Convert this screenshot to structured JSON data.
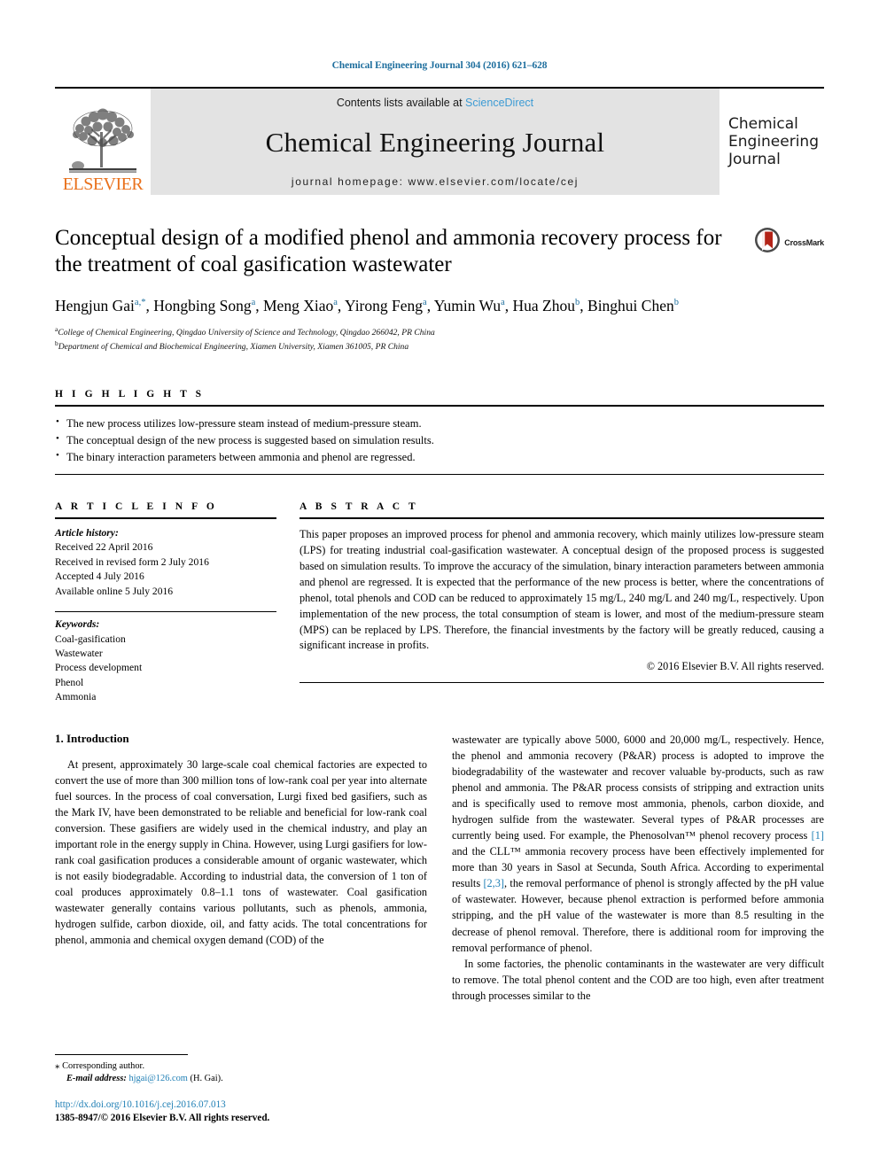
{
  "running_head": "Chemical Engineering Journal 304 (2016) 621–628",
  "masthead": {
    "contents_prefix": "Contents lists available at ",
    "sciencedirect": "ScienceDirect",
    "journal_name": "Chemical Engineering Journal",
    "homepage": "journal homepage: www.elsevier.com/locate/cej",
    "publisher_wordmark": "ELSEVIER",
    "cover_line1": "Chemical",
    "cover_line2": "Engineering",
    "cover_line3": "Journal",
    "band_color": "#e3e3e3",
    "sciencedirect_color": "#3d9bd4",
    "elsevier_orange": "#E9711C"
  },
  "article": {
    "title": "Conceptual design of a modified phenol and ammonia recovery process for the treatment of coal gasification wastewater",
    "crossmark_label": "CrossMark",
    "authors": [
      {
        "name": "Hengjun Gai",
        "marks": "a,*"
      },
      {
        "name": "Hongbing Song",
        "marks": "a"
      },
      {
        "name": "Meng Xiao",
        "marks": "a"
      },
      {
        "name": "Yirong Feng",
        "marks": "a"
      },
      {
        "name": "Yumin Wu",
        "marks": "a"
      },
      {
        "name": "Hua Zhou",
        "marks": "b"
      },
      {
        "name": "Binghui Chen",
        "marks": "b"
      }
    ],
    "affiliations": [
      {
        "mark": "a",
        "text": "College of Chemical Engineering, Qingdao University of Science and Technology, Qingdao 266042, PR China"
      },
      {
        "mark": "b",
        "text": "Department of Chemical and Biochemical Engineering, Xiamen University, Xiamen 361005, PR China"
      }
    ]
  },
  "highlights": {
    "heading": "H I G H L I G H T S",
    "items": [
      "The new process utilizes low-pressure steam instead of medium-pressure steam.",
      "The conceptual design of the new process is suggested based on simulation results.",
      "The binary interaction parameters between ammonia and phenol are regressed."
    ]
  },
  "article_info": {
    "heading": "A R T I C L E   I N F O",
    "history_title": "Article history:",
    "history": [
      "Received 22 April 2016",
      "Received in revised form 2 July 2016",
      "Accepted 4 July 2016",
      "Available online 5 July 2016"
    ],
    "keywords_title": "Keywords:",
    "keywords": [
      "Coal-gasification",
      "Wastewater",
      "Process development",
      "Phenol",
      "Ammonia"
    ]
  },
  "abstract": {
    "heading": "A B S T R A C T",
    "text": "This paper proposes an improved process for phenol and ammonia recovery, which mainly utilizes low-pressure steam (LPS) for treating industrial coal-gasification wastewater. A conceptual design of the proposed process is suggested based on simulation results. To improve the accuracy of the simulation, binary interaction parameters between ammonia and phenol are regressed. It is expected that the performance of the new process is better, where the concentrations of phenol, total phenols and COD can be reduced to approximately 15 mg/L, 240 mg/L and 240 mg/L, respectively. Upon implementation of the new process, the total consumption of steam is lower, and most of the medium-pressure steam (MPS) can be replaced by LPS. Therefore, the financial investments by the factory will be greatly reduced, causing a significant increase in profits.",
    "copyright": "© 2016 Elsevier B.V. All rights reserved."
  },
  "body": {
    "section_heading": "1. Introduction",
    "left_paragraph_1": "At present, approximately 30 large-scale coal chemical factories are expected to convert the use of more than 300 million tons of low-rank coal per year into alternate fuel sources. In the process of coal conversation, Lurgi fixed bed gasifiers, such as the Mark IV, have been demonstrated to be reliable and beneficial for low-rank coal conversion. These gasifiers are widely used in the chemical industry, and play an important role in the energy supply in China. However, using Lurgi gasifiers for low-rank coal gasification produces a considerable amount of organic wastewater, which is not easily biodegradable. According to industrial data, the conversion of 1 ton of coal produces approximately 0.8–1.1 tons of wastewater. Coal gasification wastewater generally contains various pollutants, such as phenols, ammonia, hydrogen sulfide, carbon dioxide, oil, and fatty acids. The total concentrations for phenol, ammonia and chemical oxygen demand (COD) of the",
    "right_paragraph_1_a": "wastewater are typically above 5000, 6000 and 20,000 mg/L, respectively. Hence, the phenol and ammonia recovery (P&AR) process is adopted to improve the biodegradability of the wastewater and recover valuable by-products, such as raw phenol and ammonia. The P&AR process consists of stripping and extraction units and is specifically used to remove most ammonia, phenols, carbon dioxide, and hydrogen sulfide from the wastewater. Several types of P&AR processes are currently being used. For example, the Phenosolvan™ phenol recovery process ",
    "right_ref_1": "[1]",
    "right_paragraph_1_b": " and the CLL™ ammonia recovery process have been effectively implemented for more than 30 years in Sasol at Secunda, South Africa. According to experimental results ",
    "right_ref_2": "[2,3]",
    "right_paragraph_1_c": ", the removal performance of phenol is strongly affected by the pH value of wastewater. However, because phenol extraction is performed before ammonia stripping, and the pH value of the wastewater is more than 8.5 resulting in the decrease of phenol removal. Therefore, there is additional room for improving the removal performance of phenol.",
    "right_paragraph_2": "In some factories, the phenolic contaminants in the wastewater are very difficult to remove. The total phenol content and the COD are too high, even after treatment through processes similar to the"
  },
  "footer": {
    "corresponding_star": "⁎",
    "corresponding_text": "Corresponding author.",
    "email_label": "E-mail address:",
    "email_address": "hjgai@126.com",
    "email_suffix": "(H. Gai).",
    "doi": "http://dx.doi.org/10.1016/j.cej.2016.07.013",
    "issn_line": "1385-8947/© 2016 Elsevier B.V. All rights reserved.",
    "link_color": "#1f7fb5"
  }
}
